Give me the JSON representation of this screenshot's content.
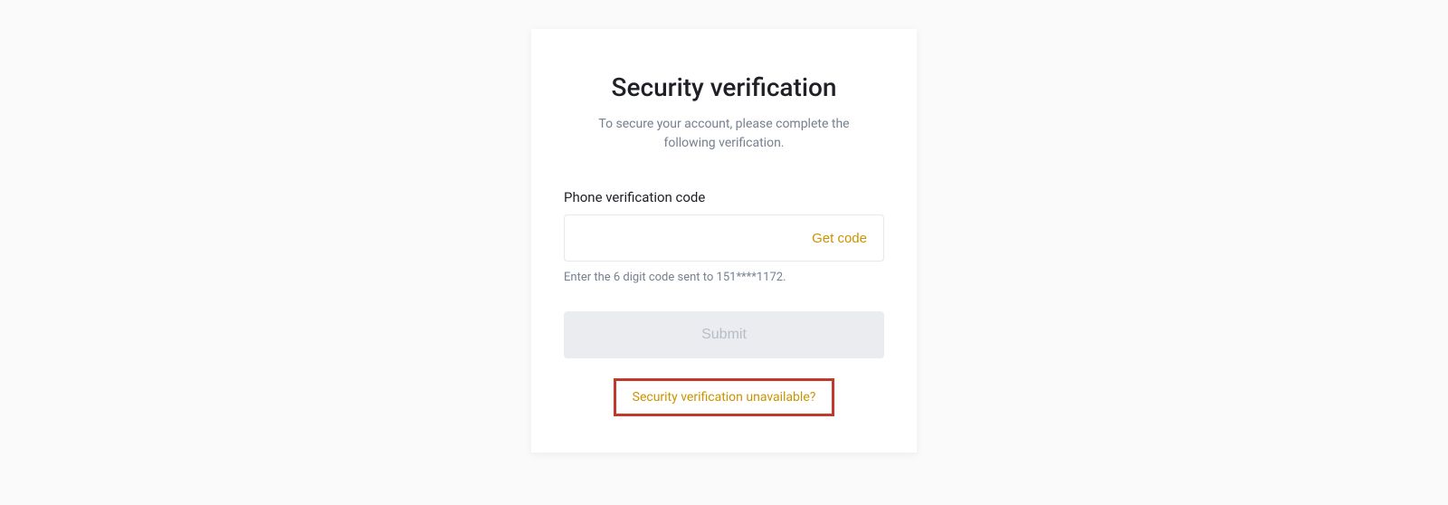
{
  "header": {
    "title": "Security verification",
    "subtitle": "To secure your account, please complete the following verification."
  },
  "phone_field": {
    "label": "Phone verification code",
    "value": "",
    "get_code_label": "Get code",
    "hint": "Enter the 6 digit code sent to 151****1172."
  },
  "submit_label": "Submit",
  "unavailable_link_label": "Security verification unavailable?",
  "colors": {
    "accent": "#c99400",
    "highlight_border": "#c0392b"
  }
}
